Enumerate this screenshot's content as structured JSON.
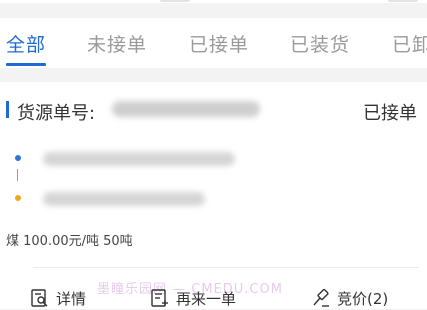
{
  "tabs": [
    {
      "label": "全部",
      "active": true
    },
    {
      "label": "未接单",
      "active": false
    },
    {
      "label": "已接单",
      "active": false
    },
    {
      "label": "已装货",
      "active": false
    },
    {
      "label": "已卸",
      "active": false
    }
  ],
  "order": {
    "source_label": "货源单号:",
    "status": "已接单",
    "cargo_line": "煤  100.00元/吨  50吨"
  },
  "actions": {
    "detail": "详情",
    "reorder": "再来一单",
    "bid": "竞价(2)"
  },
  "watermark": "墨瞳乐园网 — CMEDU.COM",
  "colors": {
    "accent": "#1f6bd6",
    "start_dot": "#2f75d8",
    "end_dot": "#f2a71b"
  }
}
